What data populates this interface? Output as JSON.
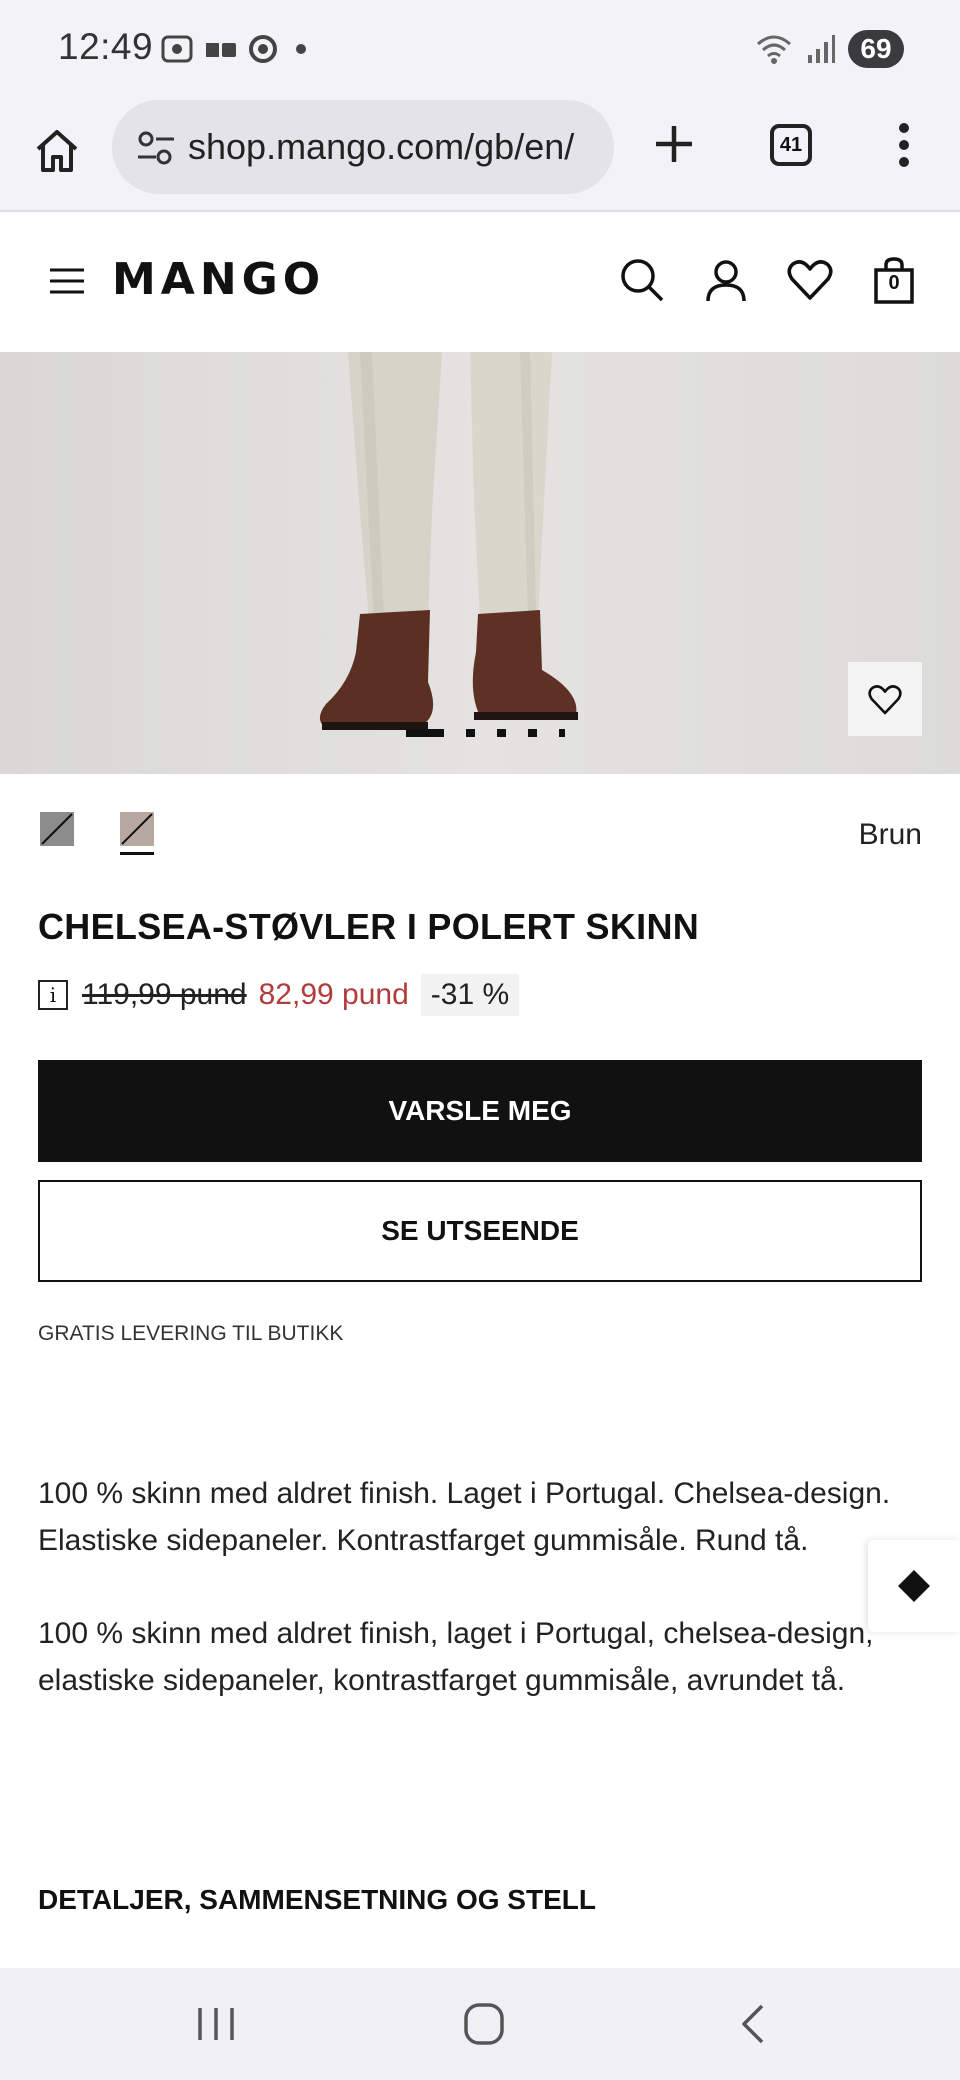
{
  "status_bar": {
    "time": "12:49",
    "battery": "69",
    "icons_left": [
      "screenshot-icon",
      "sim-icon",
      "chrome-icon",
      "dot-icon"
    ],
    "icons_right": [
      "wifi-icon",
      "signal-icon",
      "battery-icon"
    ]
  },
  "browser": {
    "url": "shop.mango.com/gb/en/",
    "tab_count": "41",
    "icons": [
      "home-icon",
      "tune-icon",
      "plus-icon",
      "tabs-icon",
      "more-vert-icon"
    ]
  },
  "header": {
    "logo": "MANGO",
    "cart_count": "0",
    "icons": [
      "menu-icon",
      "search-icon",
      "account-icon",
      "heart-icon",
      "bag-icon"
    ]
  },
  "gallery": {
    "image_count": 5,
    "active_index": 0
  },
  "product": {
    "color_name": "Brun",
    "swatches": [
      {
        "label": "grey",
        "color": "#8c8c8c"
      },
      {
        "label": "brown",
        "color": "#b7a9a2"
      }
    ],
    "selected_swatch": 1,
    "title": "CHELSEA-STØVLER I POLERT SKINN",
    "old_price": "119,99 pund",
    "new_price": "82,99 pund",
    "discount": "-31 %",
    "price_color": "#b23b3b",
    "notify_button": "VARSLE MEG",
    "look_button": "SE UTSEENDE",
    "delivery_note": "GRATIS LEVERING TIL BUTIKK",
    "description_1": "100 % skinn med aldret finish. Laget i Portugal. Chelsea-design. Elastiske sidepaneler. Kontrastfarget gummisåle. Rund tå.",
    "description_2": "100 % skinn med aldret finish, laget i Portugal, chelsea-design, elastiske sidepaneler, kontrastfarget gummisåle, avrundet tå.",
    "details_heading": "DETALJER, SAMMENSETNING OG STELL"
  },
  "nav_bar": {
    "icons": [
      "recents-icon",
      "home-circle-icon",
      "back-icon"
    ]
  }
}
